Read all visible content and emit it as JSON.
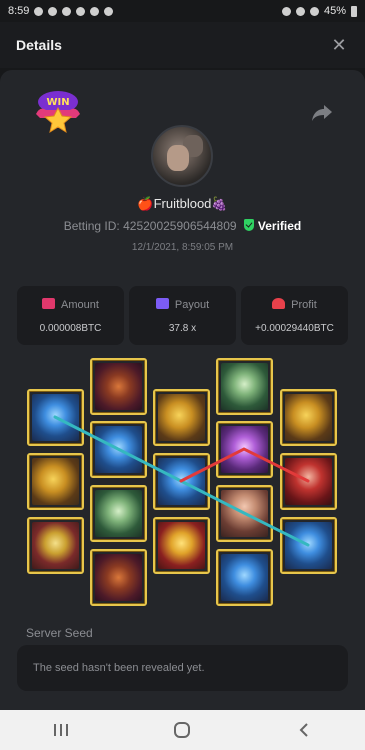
{
  "status_bar": {
    "time": "8:59",
    "battery": "45%"
  },
  "header": {
    "title": "Details",
    "close_glyph": "✕"
  },
  "user": {
    "name": "🍎Fruitblood🍇"
  },
  "bet": {
    "betting_id_label": "Betting ID:",
    "betting_id": "42520025906544809",
    "verified_label": "Verified",
    "date": "12/1/2021, 8:59:05 PM"
  },
  "stats": {
    "amount": {
      "label": "Amount",
      "value": "0.000008BTC",
      "color": "#e0386c"
    },
    "payout": {
      "label": "Payout",
      "value": "37.8 x",
      "color": "#7c5cf5"
    },
    "profit": {
      "label": "Profit",
      "value": "+0.00029440BTC",
      "color": "#e8414b"
    }
  },
  "reels": [
    [
      "lotus",
      "golden-pipa",
      "jade-comb"
    ],
    [
      "pipa-lute",
      "lotus",
      "jade-fan",
      "pipa-lute"
    ],
    [
      "golden-pipa",
      "lotus",
      "gold-ingots"
    ],
    [
      "jade-fan",
      "lotus-pendant",
      "lady",
      "lotus"
    ],
    [
      "golden-pipa",
      "lady-red",
      "lotus"
    ]
  ],
  "colors": {
    "tile_border": "#e7c64c",
    "win_line_teal": "#35b8c0",
    "win_line_red": "#e23a3a"
  },
  "server_seed": {
    "label": "Server Seed",
    "message": "The seed hasn't been revealed yet."
  },
  "icons": [
    "win-badge-icon",
    "share-icon",
    "verified-shield-icon",
    "close-icon",
    "nav-recent-icon",
    "nav-home-icon",
    "nav-back-icon"
  ]
}
